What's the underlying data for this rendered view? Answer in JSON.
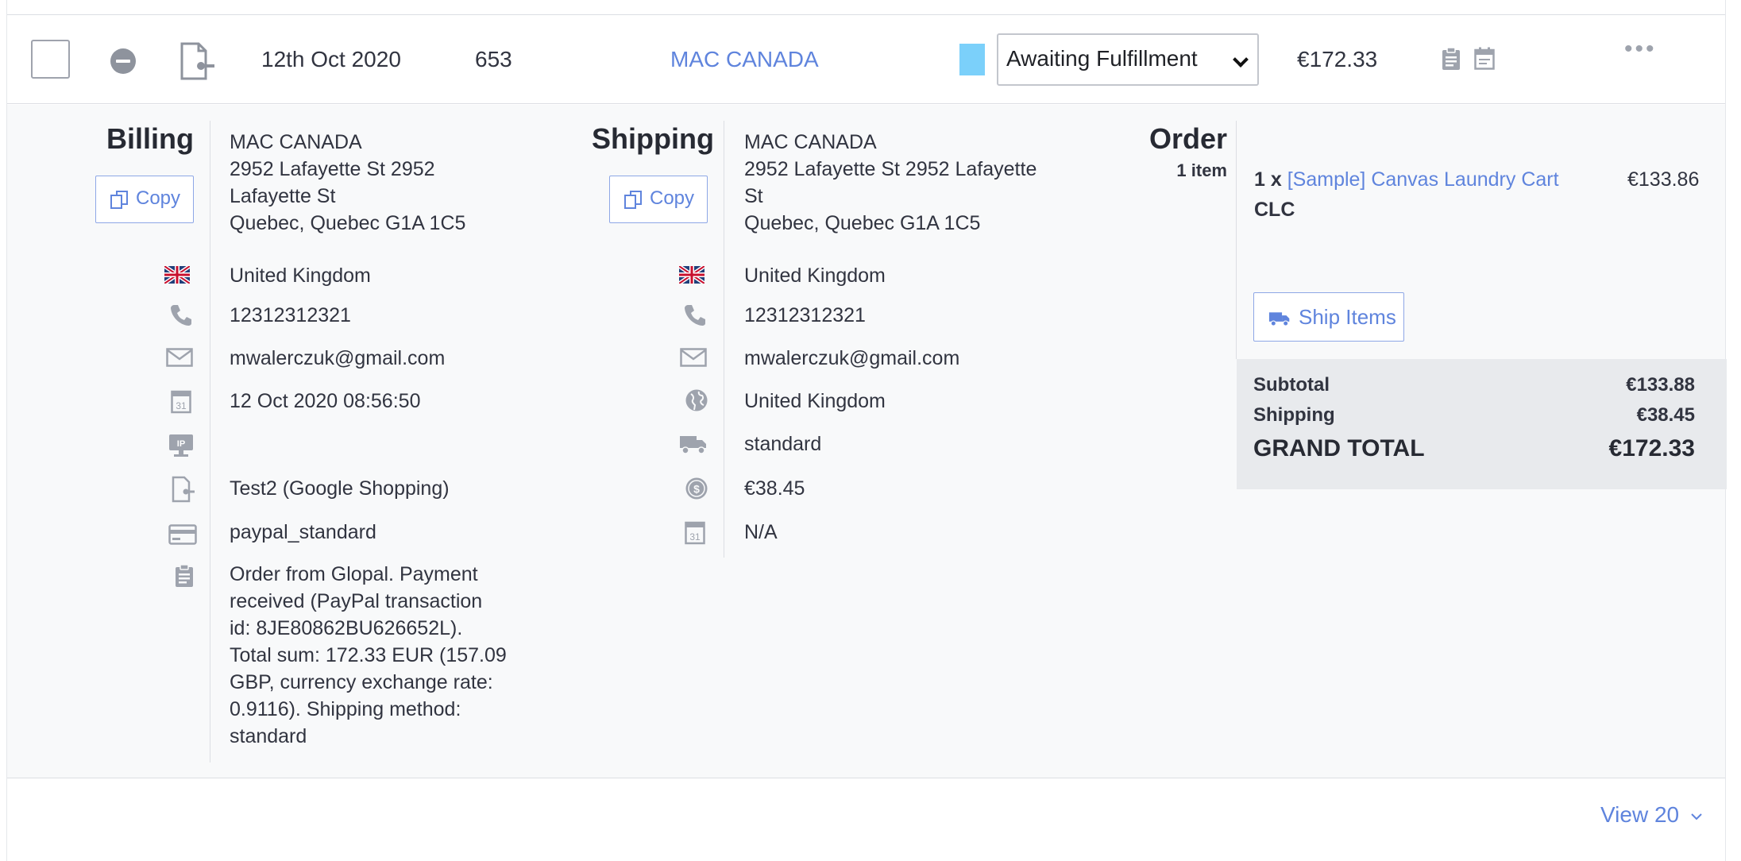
{
  "order_row": {
    "date": "12th Oct 2020",
    "order_number": "653",
    "customer": "MAC CANADA",
    "status": {
      "selected": "Awaiting Fulfillment",
      "swatch_color": "#7bd0fa"
    },
    "total": "€172.33",
    "actions_label": "•••"
  },
  "billing": {
    "heading": "Billing",
    "copy_label": "Copy",
    "name": "MAC CANADA",
    "address_line1": "2952 Lafayette St 2952",
    "address_line2": "Lafayette St",
    "address_line3": "Quebec, Quebec G1A 1C5",
    "country": "United Kingdom",
    "phone": "12312312321",
    "email": "mwalerczuk@gmail.com",
    "date": "12 Oct 2020 08:56:50",
    "channel": "Test2 (Google Shopping)",
    "payment": "paypal_standard",
    "notes": [
      "Order from Glopal. Payment",
      "received (PayPal transaction",
      "id: 8JE80862BU626652L).",
      "Total sum: 172.33 EUR (157.09",
      "GBP, currency exchange rate:",
      "0.9116). Shipping method:",
      "standard"
    ]
  },
  "shipping": {
    "heading": "Shipping",
    "copy_label": "Copy",
    "name": "MAC CANADA",
    "address_line1": "2952 Lafayette St 2952 Lafayette",
    "address_line2": "St",
    "address_line3": "Quebec, Quebec G1A 1C5",
    "country": "United Kingdom",
    "phone": "12312312321",
    "email": "mwalerczuk@gmail.com",
    "region": "United Kingdom",
    "method": "standard",
    "cost": "€38.45",
    "date": "N/A"
  },
  "order": {
    "heading": "Order",
    "item_count": "1 item",
    "item": {
      "qty": "1 x",
      "name": "[Sample] Canvas Laundry Cart",
      "sku": "CLC",
      "price": "€133.86"
    },
    "ship_label": "Ship Items",
    "subtotal_label": "Subtotal",
    "subtotal": "€133.88",
    "shipping_label": "Shipping",
    "shipping": "€38.45",
    "grand_label": "GRAND TOTAL",
    "grand_total": "€172.33"
  },
  "footer": {
    "view_label": "View 20"
  },
  "icons": [
    "checkbox",
    "minus-circle-icon",
    "channel-doc-icon",
    "clipboard-icon",
    "calendar-icon",
    "more-icon",
    "copy-icon",
    "uk-flag-icon",
    "phone-icon",
    "mail-icon",
    "ip-icon",
    "card-icon",
    "globe-icon",
    "truck-icon",
    "dollar-coin-icon",
    "chevron-down-icon"
  ]
}
